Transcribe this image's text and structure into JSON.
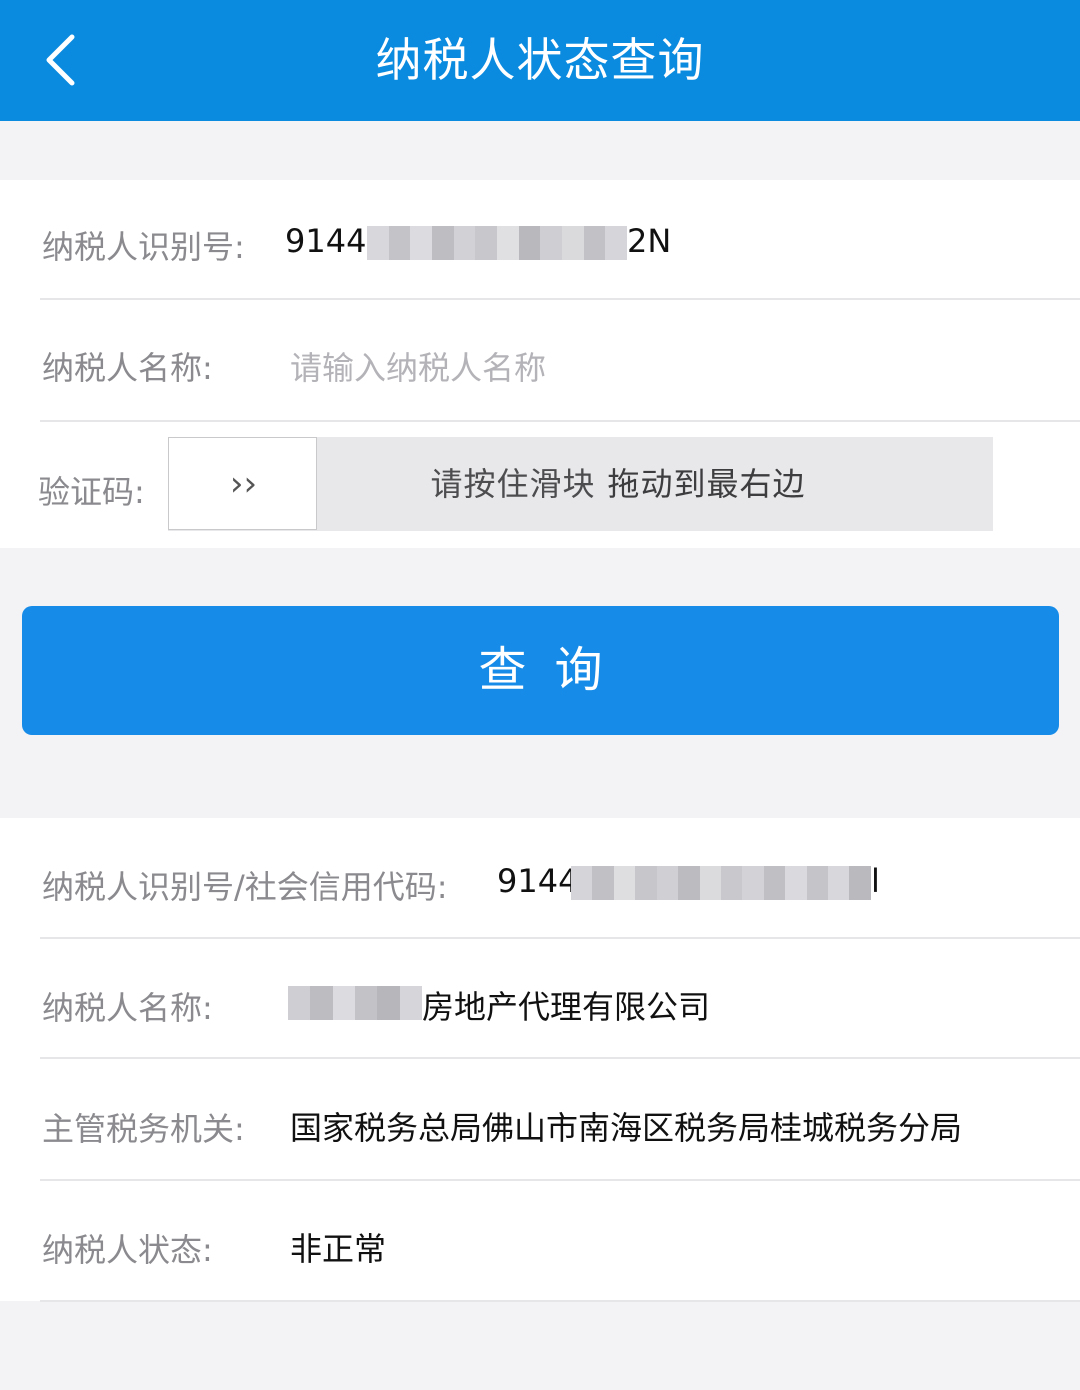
{
  "header": {
    "title": "纳税人状态查询",
    "back_icon": "chevron-left-icon",
    "background": "#0a8be0"
  },
  "form": {
    "taxpayer_id": {
      "label": "纳税人识别号:",
      "value_prefix": "9144(",
      "value_suffix": "2N"
    },
    "taxpayer_name": {
      "label": "纳税人名称:",
      "placeholder": "请输入纳税人名称"
    },
    "captcha": {
      "label": "验证码:",
      "handle_icon": "double-chevron-right-icon",
      "handle_glyph": "››",
      "hint_part1": "请按住滑块",
      "hint_part2": "拖动到最右边"
    }
  },
  "query_button": {
    "label": "查询",
    "color": "#168be8"
  },
  "result": {
    "credit_code": {
      "label": "纳税人识别号/社会信用代码:",
      "value_prefix": "9144",
      "value_suffix": "l"
    },
    "name": {
      "label": "纳税人名称:",
      "value_suffix": "房地产代理有限公司"
    },
    "authority": {
      "label": "主管税务机关:",
      "value": "国家税务总局佛山市南海区税务局桂城税务分局"
    },
    "status": {
      "label": "纳税人状态:",
      "value": "非正常"
    }
  }
}
